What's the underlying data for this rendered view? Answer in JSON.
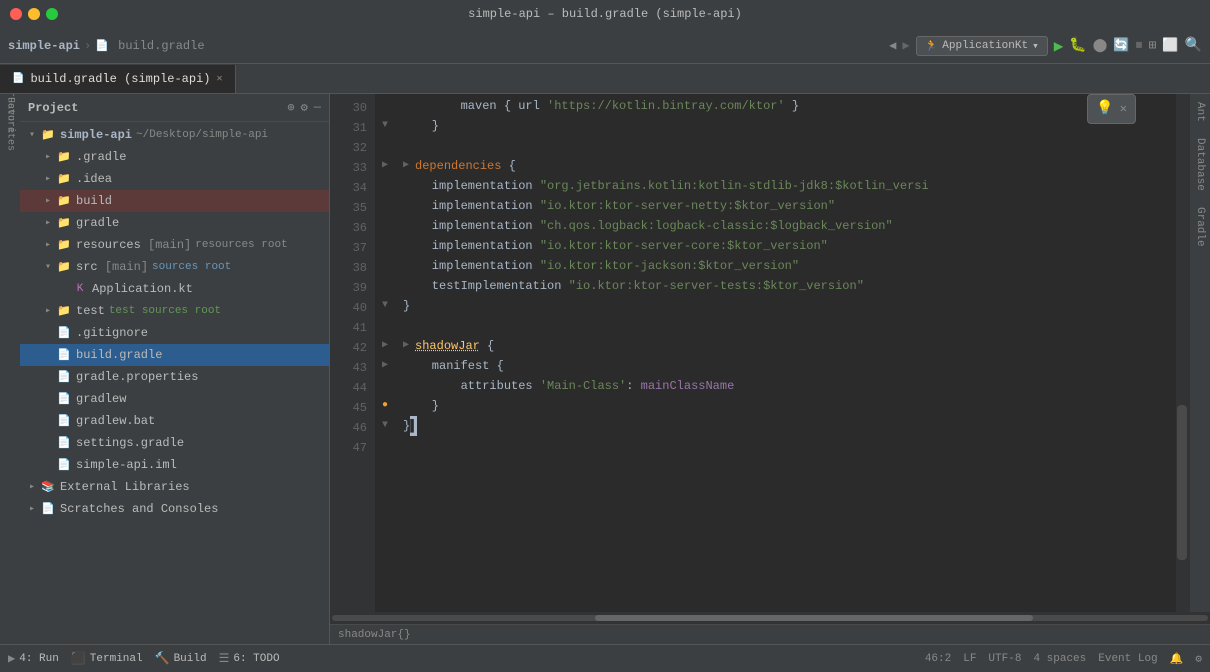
{
  "window": {
    "title": "simple-api – build.gradle (simple-api)"
  },
  "titlebar": {
    "title": "simple-api – build.gradle (simple-api)"
  },
  "toolbar": {
    "breadcrumb_project": "simple-api",
    "breadcrumb_file": "build.gradle",
    "run_config": "ApplicationKt",
    "run_dropdown": "▾"
  },
  "tabs": [
    {
      "label": "build.gradle (simple-api)",
      "icon": "📄",
      "active": true
    }
  ],
  "sidebar": {
    "title": "Project",
    "items": [
      {
        "label": "simple-api",
        "path": "~/Desktop/simple-api",
        "indent": 0,
        "type": "project",
        "expanded": true,
        "icon": "project"
      },
      {
        "label": ".gradle",
        "indent": 1,
        "type": "folder",
        "expanded": false,
        "icon": "folder"
      },
      {
        "label": ".idea",
        "indent": 1,
        "type": "folder",
        "expanded": false,
        "icon": "folder"
      },
      {
        "label": "build",
        "indent": 1,
        "type": "folder",
        "expanded": false,
        "icon": "folder",
        "highlighted": true
      },
      {
        "label": "gradle",
        "indent": 1,
        "type": "folder",
        "expanded": false,
        "icon": "folder"
      },
      {
        "label": "resources",
        "indent": 1,
        "type": "folder",
        "label2": "[main]",
        "label3": "resources root",
        "expanded": false,
        "icon": "folder-blue"
      },
      {
        "label": "src",
        "indent": 1,
        "type": "folder",
        "label2": "[main]",
        "label3": "sources root",
        "expanded": true,
        "icon": "folder-src"
      },
      {
        "label": "Application.kt",
        "indent": 3,
        "type": "kotlin",
        "icon": "kotlin"
      },
      {
        "label": "test",
        "indent": 1,
        "type": "folder",
        "label2": "test sources root",
        "expanded": false,
        "icon": "folder-test"
      },
      {
        "label": ".gitignore",
        "indent": 1,
        "type": "file",
        "icon": "file"
      },
      {
        "label": "build.gradle",
        "indent": 1,
        "type": "gradle",
        "icon": "gradle",
        "selected": true
      },
      {
        "label": "gradle.properties",
        "indent": 1,
        "type": "properties",
        "icon": "properties"
      },
      {
        "label": "gradlew",
        "indent": 1,
        "type": "file",
        "icon": "file"
      },
      {
        "label": "gradlew.bat",
        "indent": 1,
        "type": "file",
        "icon": "file"
      },
      {
        "label": "settings.gradle",
        "indent": 1,
        "type": "gradle",
        "icon": "gradle"
      },
      {
        "label": "simple-api.iml",
        "indent": 1,
        "type": "file",
        "icon": "file"
      },
      {
        "label": "External Libraries",
        "indent": 0,
        "type": "folder",
        "expanded": false,
        "icon": "folder"
      },
      {
        "label": "Scratches and Consoles",
        "indent": 0,
        "type": "folder",
        "expanded": false,
        "icon": "folder"
      }
    ]
  },
  "editor": {
    "lines": [
      {
        "num": 30,
        "content": [
          {
            "t": "        maven { url '",
            "c": "punct"
          },
          {
            "t": "https://kotlin.bintray.com/ktor",
            "c": "str"
          },
          {
            "t": "' }",
            "c": "punct"
          }
        ],
        "gutter": ""
      },
      {
        "num": 31,
        "content": [
          {
            "t": "    }",
            "c": "punct"
          }
        ],
        "gutter": "fold"
      },
      {
        "num": 32,
        "content": [],
        "gutter": ""
      },
      {
        "num": 33,
        "content": [
          {
            "t": "▶",
            "c": "fold"
          },
          {
            "t": " ",
            "c": ""
          },
          {
            "t": "dependencies",
            "c": "kw"
          },
          {
            "t": " {",
            "c": "punct"
          }
        ],
        "gutter": "fold-open"
      },
      {
        "num": 34,
        "content": [
          {
            "t": "    ",
            "c": ""
          },
          {
            "t": "implementation",
            "c": "method"
          },
          {
            "t": " ",
            "c": ""
          },
          {
            "t": "\"org.jetbrains.kotlin:kotlin-stdlib-jdk8:$kotlin_versi",
            "c": "str"
          }
        ],
        "gutter": ""
      },
      {
        "num": 35,
        "content": [
          {
            "t": "    ",
            "c": ""
          },
          {
            "t": "implementation",
            "c": "method"
          },
          {
            "t": " ",
            "c": ""
          },
          {
            "t": "\"io.ktor:ktor-server-netty:$ktor_version\"",
            "c": "str"
          }
        ],
        "gutter": ""
      },
      {
        "num": 36,
        "content": [
          {
            "t": "    ",
            "c": ""
          },
          {
            "t": "implementation",
            "c": "method"
          },
          {
            "t": " ",
            "c": ""
          },
          {
            "t": "\"ch.qos.logback:logback-classic:$logback_version\"",
            "c": "str"
          }
        ],
        "gutter": ""
      },
      {
        "num": 37,
        "content": [
          {
            "t": "    ",
            "c": ""
          },
          {
            "t": "implementation",
            "c": "method"
          },
          {
            "t": " ",
            "c": ""
          },
          {
            "t": "\"io.ktor:ktor-server-core:$ktor_version\"",
            "c": "str"
          }
        ],
        "gutter": ""
      },
      {
        "num": 38,
        "content": [
          {
            "t": "    ",
            "c": ""
          },
          {
            "t": "implementation",
            "c": "method"
          },
          {
            "t": " ",
            "c": ""
          },
          {
            "t": "\"io.ktor:ktor-jackson:$ktor_version\"",
            "c": "str"
          }
        ],
        "gutter": ""
      },
      {
        "num": 39,
        "content": [
          {
            "t": "    ",
            "c": ""
          },
          {
            "t": "testImplementation",
            "c": "method"
          },
          {
            "t": " ",
            "c": ""
          },
          {
            "t": "\"io.ktor:ktor-server-tests:$ktor_version\"",
            "c": "str"
          }
        ],
        "gutter": ""
      },
      {
        "num": 40,
        "content": [
          {
            "t": "}",
            "c": "punct"
          }
        ],
        "gutter": "fold"
      },
      {
        "num": 41,
        "content": [],
        "gutter": ""
      },
      {
        "num": 42,
        "content": [
          {
            "t": "▶",
            "c": "fold"
          },
          {
            "t": " ",
            "c": ""
          },
          {
            "t": "shadowJar",
            "c": "fn"
          },
          {
            "t": " {",
            "c": "punct"
          }
        ],
        "gutter": "fold-open"
      },
      {
        "num": 43,
        "content": [
          {
            "t": "    ",
            "c": ""
          },
          {
            "t": "manifest",
            "c": "method"
          },
          {
            "t": " {",
            "c": "punct"
          }
        ],
        "gutter": "fold-open"
      },
      {
        "num": 44,
        "content": [
          {
            "t": "        ",
            "c": ""
          },
          {
            "t": "attributes",
            "c": "method"
          },
          {
            "t": " ",
            "c": ""
          },
          {
            "t": "'Main-Class'",
            "c": "str-sq"
          },
          {
            "t": ": ",
            "c": "punct"
          },
          {
            "t": "mainClassName",
            "c": "var"
          }
        ],
        "gutter": ""
      },
      {
        "num": 45,
        "content": [
          {
            "t": "    }",
            "c": "punct"
          }
        ],
        "gutter": "fold-warning"
      },
      {
        "num": 46,
        "content": [
          {
            "t": "}",
            "c": "punct"
          },
          {
            "t": "▌",
            "c": "cursor"
          }
        ],
        "gutter": "fold"
      },
      {
        "num": 47,
        "content": [],
        "gutter": ""
      }
    ]
  },
  "right_panel_labels": [
    "Ant",
    "Database",
    "Gradle"
  ],
  "bottom_tabs": [
    {
      "label": "▶ 4: Run",
      "icon": "▶"
    },
    {
      "label": "Terminal",
      "icon": "⬛"
    },
    {
      "label": "Build",
      "icon": "🔨"
    },
    {
      "label": "≡ 6: TODO",
      "icon": "≡"
    }
  ],
  "status_bar": {
    "position": "46:2",
    "line_sep": "LF",
    "encoding": "UTF-8",
    "indent": "4 spaces"
  },
  "filename_bar": {
    "text": "shadowJar{}"
  },
  "suggestion": {
    "icon": "💡"
  }
}
